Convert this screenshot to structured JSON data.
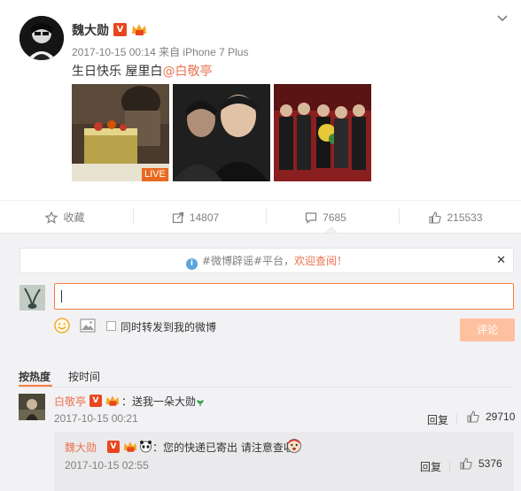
{
  "post": {
    "username": "魏大勋",
    "v_badge": "V",
    "meta": "2017-10-15 00:14 来自 iPhone 7 Plus",
    "text_prefix": "生日快乐 屋里白",
    "mention": "@白敬亭",
    "live_tag": "LIVE"
  },
  "actions": {
    "favorite_label": "收藏",
    "repost_count": "14807",
    "comment_count": "7685",
    "like_count": "215533"
  },
  "comment_box": {
    "notice_prefix": "#微博辟谣#平台，",
    "notice_highlight": "欢迎查阅！",
    "close_glyph": "✕",
    "info_glyph": "i",
    "input_value": "",
    "repost_label": "同时转发到我的微博",
    "submit_label": "评论"
  },
  "sort": {
    "hot_label": "按热度",
    "time_label": "按时间"
  },
  "comments": [
    {
      "username": "白敬亭",
      "v_badge": "V",
      "text": "：送我一朵大勋",
      "time": "2017-10-15 00:21",
      "reply_label": "回复",
      "likes": "29710",
      "replies": [
        {
          "username": "魏大勋",
          "v_badge": "V",
          "text": "：您的快递已寄出 请注意查收",
          "time": "2017-10-15 02:55",
          "reply_label": "回复",
          "likes": "5376"
        }
      ]
    }
  ],
  "colors": {
    "accent": "#eb7350",
    "input_border": "#fa7d3c",
    "submit_disabled": "#ffc09f",
    "badge_v": "#e8461e",
    "info_blue": "#5aa4db",
    "muted_text": "#808080"
  },
  "icons": {
    "favorite": "star-outline-icon",
    "repost": "share-arrow-icon",
    "comment": "speech-bubble-icon",
    "like": "thumbs-up-icon",
    "menu": "chevron-down-icon",
    "emoji": "smiley-icon",
    "picture": "image-icon"
  }
}
